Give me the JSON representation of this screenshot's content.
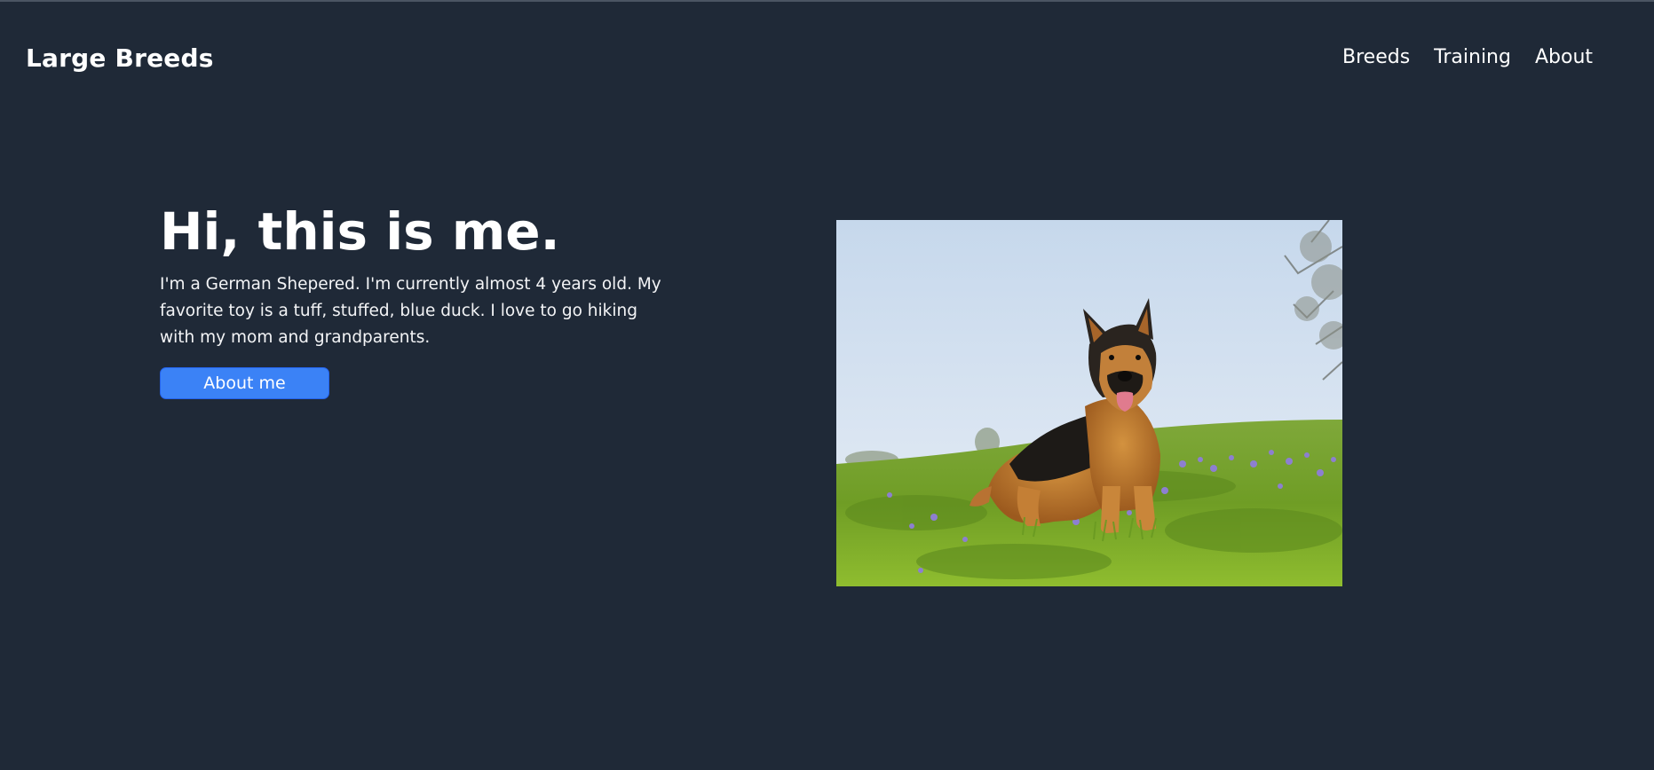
{
  "header": {
    "brand": "Large Breeds",
    "nav": {
      "breeds": "Breeds",
      "training": "Training",
      "about": "About"
    }
  },
  "hero": {
    "title": "Hi, this is me.",
    "body": "I'm a German Shepered. I'm currently almost 4 years old. My favorite toy is a tuff, stuffed, blue duck. I love to go hiking with my mom and grandparents.",
    "button_label": "About me",
    "image_subject": "german-shepherd-in-grass-photo"
  },
  "colors": {
    "background": "#1f2937",
    "text": "#ffffff",
    "button": "#3b82f6"
  }
}
